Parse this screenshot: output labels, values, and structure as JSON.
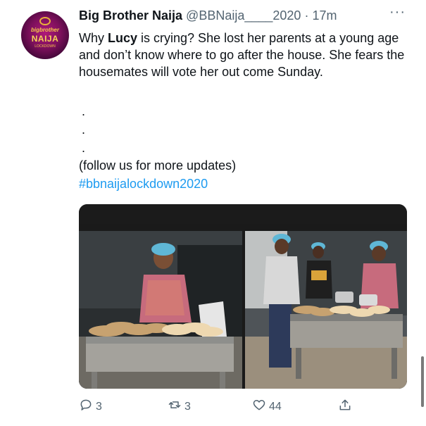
{
  "tweet": {
    "author_name": "Big Brother Naija",
    "handle": "@BBNaija____2020",
    "separator": "·",
    "time": "17m",
    "avatar_text": {
      "line1": "bigbrother",
      "line2": "NAIJA",
      "line3": "LOCKDOWN"
    },
    "text_pre": "Why ",
    "text_bold": "Lucy",
    "text_post": " is crying? She lost her parents at a young age and don’t know where to go after the house. She fears the housemates will vote her out come Sunday.",
    "dots": [
      ".",
      ".",
      "."
    ],
    "follow_line": "(follow us for more updates)",
    "hashtag": "#bbnaijalockdown2020"
  },
  "actions": {
    "reply_count": "3",
    "retweet_count": "3",
    "like_count": "44"
  },
  "colors": {
    "accent": "#1d9bf0",
    "muted": "#536471",
    "text": "#0f1419"
  }
}
